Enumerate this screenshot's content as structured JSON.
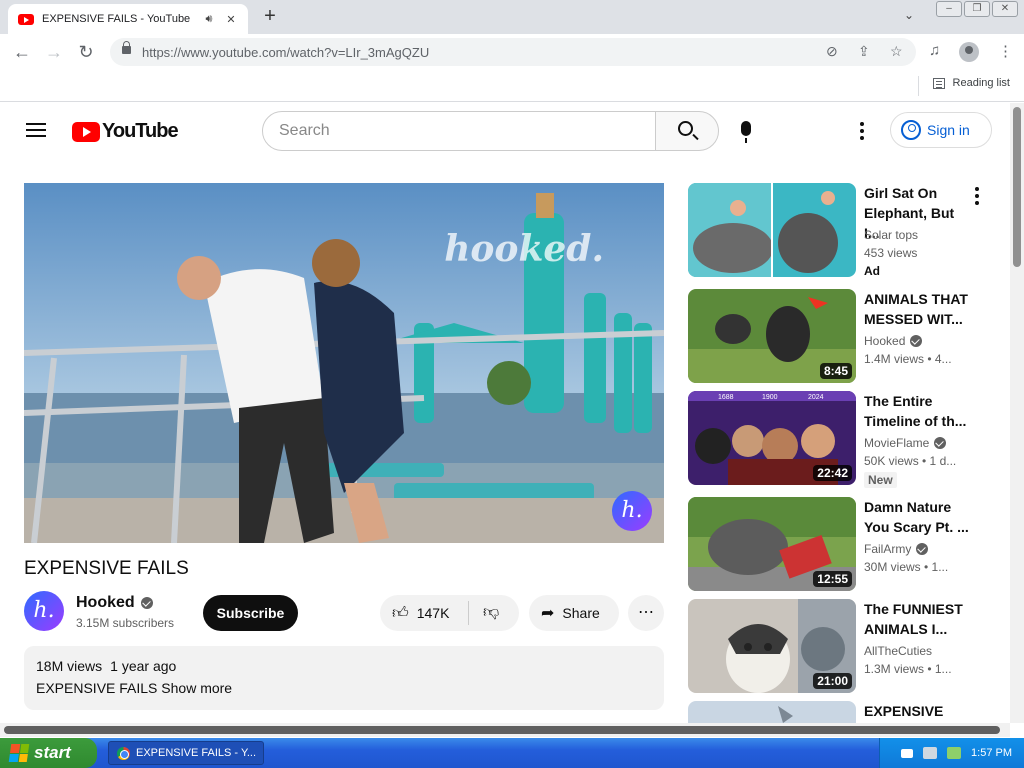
{
  "browser": {
    "tab_title": "EXPENSIVE FAILS - YouTube",
    "url": "https://www.youtube.com/watch?v=LIr_3mAgQZU",
    "reading_list": "Reading list"
  },
  "yt": {
    "logo_text": "YouTube",
    "search_placeholder": "Search",
    "sign_in": "Sign in"
  },
  "video": {
    "watermark": "hooked.",
    "badge_letter": "h.",
    "title": "EXPENSIVE FAILS",
    "channel": "Hooked",
    "subscribers": "3.15M subscribers",
    "subscribe": "Subscribe",
    "likes": "147K",
    "share": "Share",
    "views": "18M views",
    "age": "1 year ago",
    "description": "EXPENSIVE FAILS",
    "show_more": "Show more"
  },
  "sidebar": [
    {
      "title": "Girl Sat On Elephant, But I...",
      "channel": "Solar tops",
      "meta": "453 views",
      "badge": "Ad",
      "duration": "",
      "verified": false
    },
    {
      "title": "ANIMALS THAT MESSED WIT...",
      "channel": "Hooked",
      "meta": "1.4M views  • 4...",
      "badge": "",
      "duration": "8:45",
      "verified": true
    },
    {
      "title": "The Entire Timeline of th...",
      "channel": "MovieFlame",
      "meta": "50K views  • 1 d...",
      "badge": "New",
      "duration": "22:42",
      "verified": true,
      "thumb_labels": [
        "1688",
        "1900",
        "2024"
      ]
    },
    {
      "title": "Damn Nature You Scary Pt. ...",
      "channel": "FailArmy",
      "meta": "30M views  • 1...",
      "badge": "",
      "duration": "12:55",
      "verified": true
    },
    {
      "title": "The FUNNIEST ANIMALS I...",
      "channel": "AllTheCuties",
      "meta": "1.3M views  • 1...",
      "badge": "",
      "duration": "21:00",
      "verified": false
    },
    {
      "title": "EXPENSIVE",
      "channel": "",
      "meta": "",
      "badge": "",
      "duration": "",
      "verified": false
    }
  ],
  "taskbar": {
    "start": "start",
    "window": "EXPENSIVE FAILS - Y...",
    "clock": "1:57 PM"
  }
}
